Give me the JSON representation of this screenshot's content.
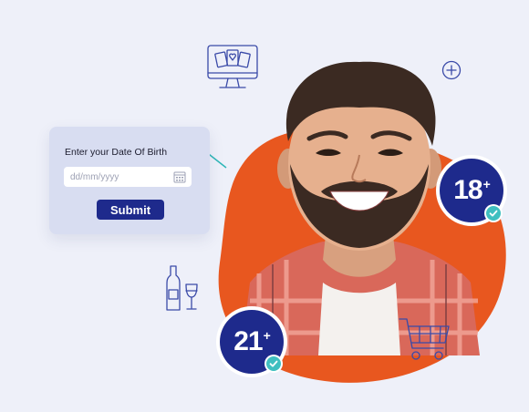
{
  "form": {
    "label": "Enter your Date Of Birth",
    "date_placeholder": "dd/mm/yyyy",
    "submit_label": "Submit"
  },
  "badges": {
    "adult_18": {
      "number": "18",
      "plus": "+"
    },
    "adult_21": {
      "number": "21",
      "plus": "+"
    }
  },
  "icons": [
    "computer-cards-icon",
    "plus-circle-icon",
    "calendar-icon",
    "wine-bottle-glass-icon",
    "shopping-cart-icon",
    "check-icon"
  ],
  "colors": {
    "background": "#eef0f9",
    "accent_orange": "#e8571f",
    "brand_navy": "#1e2a8c",
    "card_bg": "#d8ddf1",
    "check_teal": "#3fbfc0"
  }
}
